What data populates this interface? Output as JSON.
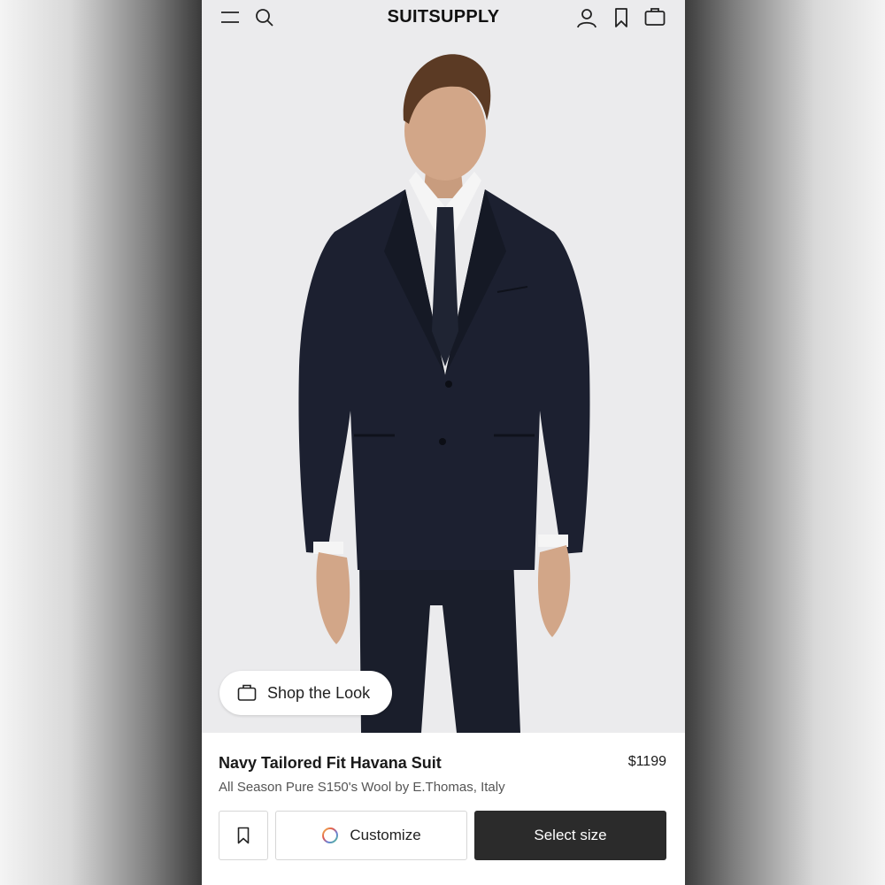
{
  "header": {
    "brand": "SUITSUPPLY",
    "icons": [
      "menu-icon",
      "search-icon",
      "account-icon",
      "bookmark-icon",
      "bag-icon"
    ]
  },
  "hero": {
    "shop_look_label": "Shop the Look"
  },
  "product": {
    "title": "Navy Tailored Fit Havana Suit",
    "price": "$1199",
    "subtitle": "All Season Pure S150's Wool by E.Thomas, Italy"
  },
  "actions": {
    "customize_label": "Customize",
    "select_size_label": "Select size"
  },
  "colors": {
    "accent_dark": "#2b2b2b",
    "suit_navy": "#1c2030",
    "background": "#ebebed"
  }
}
